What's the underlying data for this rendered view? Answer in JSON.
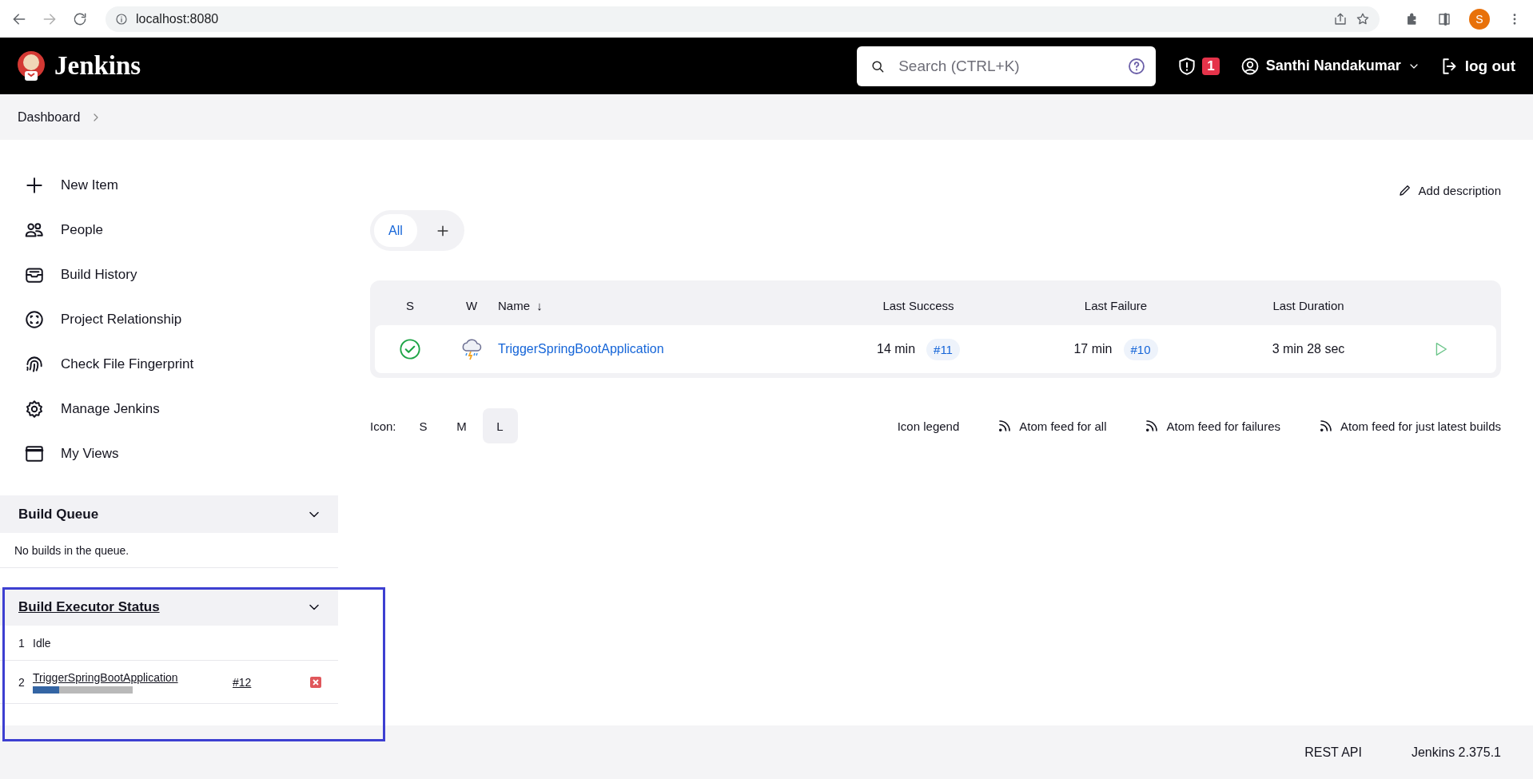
{
  "browser": {
    "address": "localhost:8080",
    "profile_initial": "S"
  },
  "header": {
    "logo": "Jenkins",
    "search": {
      "placeholder": "Search (CTRL+K)"
    },
    "security_count": "1",
    "user": "Santhi Nandakumar",
    "logout": "log out"
  },
  "breadcrumb": [
    "Dashboard"
  ],
  "sidebar": {
    "items": [
      {
        "label": "New Item"
      },
      {
        "label": "People"
      },
      {
        "label": "Build History"
      },
      {
        "label": "Project Relationship"
      },
      {
        "label": "Check File Fingerprint"
      },
      {
        "label": "Manage Jenkins"
      },
      {
        "label": "My Views"
      }
    ]
  },
  "build_queue": {
    "title": "Build Queue",
    "expanded": true,
    "message": "No builds in the queue."
  },
  "executors": {
    "title": "Build Executor Status",
    "expanded": true,
    "rows": [
      {
        "number": "1",
        "kind": "idle",
        "status": "Idle"
      },
      {
        "number": "2",
        "kind": "running",
        "job": "TriggerSpringBootApplication",
        "level": 0.26,
        "build": "#12"
      }
    ]
  },
  "main": {
    "add_description": "Add description",
    "view_tabs": [
      {
        "label": "All",
        "selected": true
      }
    ]
  },
  "table": {
    "columns": [
      {
        "label": "S"
      },
      {
        "label": "W"
      },
      {
        "label": "Name",
        "sort_arrow": "↓"
      },
      {
        "label": "Last Success"
      },
      {
        "label": "Last Failure"
      },
      {
        "label": "Last Duration"
      }
    ],
    "rows": [
      {
        "succeeded": true,
        "stormy": true,
        "name": "TriggerSpringBootApplication",
        "last_success": "14 min",
        "last_success_build": "#11",
        "last_failure": "17 min",
        "last_failure_build": "#10",
        "last_duration": "3 min 28 sec"
      }
    ]
  },
  "icon_size": {
    "label": "Icon:",
    "options": [
      {
        "label": "S",
        "selected": false
      },
      {
        "label": "M",
        "selected": false
      },
      {
        "label": "L",
        "selected": true
      }
    ]
  },
  "links": [
    {
      "kind": "legend",
      "label": "Icon legend"
    },
    {
      "kind": "feed",
      "label": "Atom feed for all"
    },
    {
      "kind": "feed",
      "label": "Atom feed for failures"
    },
    {
      "kind": "feed",
      "label": "Atom feed for just latest builds"
    }
  ],
  "footer": [
    "REST API",
    "Jenkins 2.375.1"
  ]
}
